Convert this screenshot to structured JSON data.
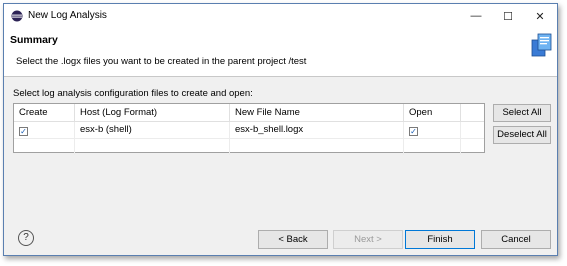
{
  "window": {
    "title": "New Log Analysis",
    "controls": {
      "minimize": "—",
      "maximize": "☐",
      "close": "✕"
    }
  },
  "banner": {
    "title": "Summary",
    "description": "Select the .logx files you want to be created in the parent project /test"
  },
  "list": {
    "label": "Select log analysis configuration files to create and open:",
    "columns": [
      "Create",
      "Host (Log Format)",
      "New File Name",
      "Open"
    ],
    "rows": [
      {
        "create": true,
        "host": "esx-b (shell)",
        "file": "esx-b_shell.logx",
        "open": true
      }
    ]
  },
  "side_buttons": {
    "select_all": "Select All",
    "deselect_all": "Deselect All"
  },
  "footer": {
    "help": "?",
    "back": "< Back",
    "next": "Next >",
    "finish": "Finish",
    "cancel": "Cancel"
  },
  "icons": {
    "app": "eclipse-icon",
    "banner": "log-file-icon",
    "check": "✓"
  }
}
